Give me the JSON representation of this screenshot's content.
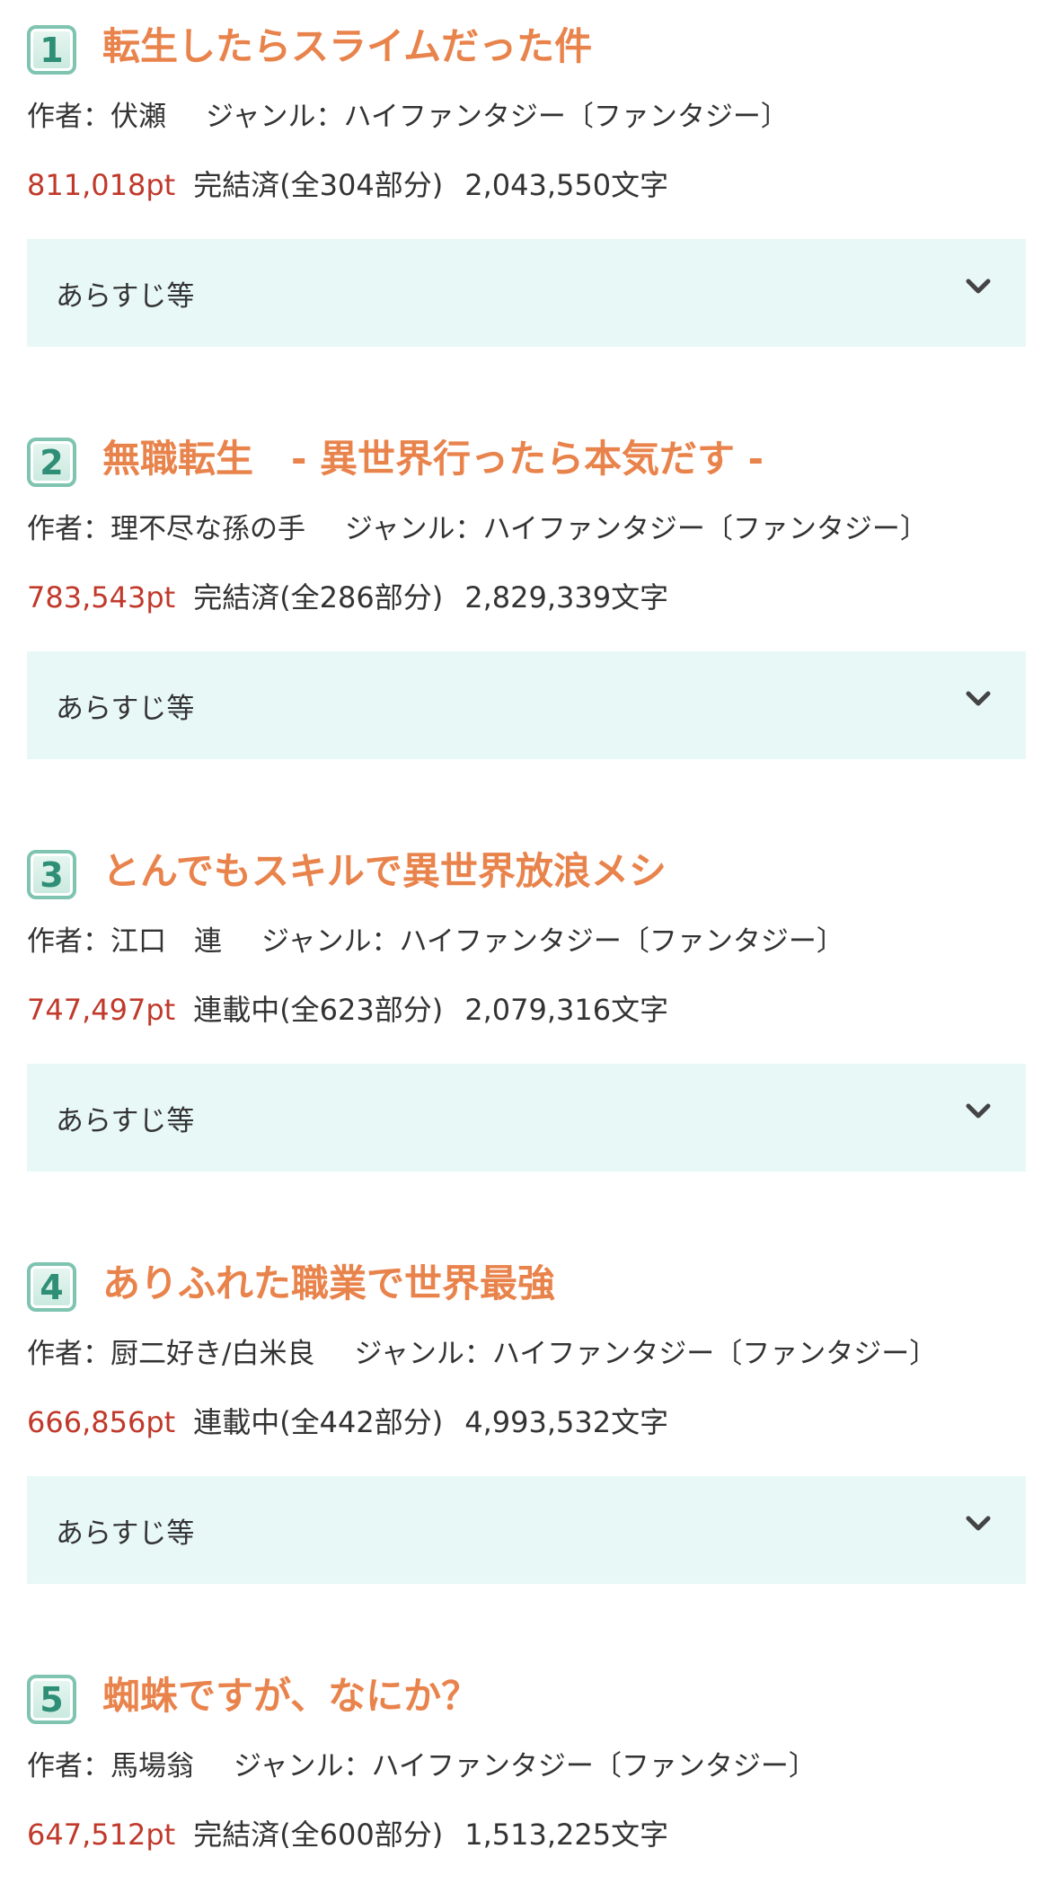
{
  "labels": {
    "author_prefix": "作者：",
    "genre_prefix": "ジャンル：",
    "synopsis": "あらすじ等"
  },
  "novels": [
    {
      "rank": "1",
      "title": "転生したらスライムだった件",
      "author": "伏瀬",
      "genre": "ハイファンタジー〔ファンタジー〕",
      "points": "811,018pt",
      "status": "完結済(全304部分)",
      "chars": "2,043,550文字"
    },
    {
      "rank": "2",
      "title": "無職転生　- 異世界行ったら本気だす -",
      "author": "理不尽な孫の手",
      "genre": "ハイファンタジー〔ファンタジー〕",
      "points": "783,543pt",
      "status": "完結済(全286部分)",
      "chars": "2,829,339文字"
    },
    {
      "rank": "3",
      "title": "とんでもスキルで異世界放浪メシ",
      "author": "江口　連",
      "genre": "ハイファンタジー〔ファンタジー〕",
      "points": "747,497pt",
      "status": "連載中(全623部分)",
      "chars": "2,079,316文字"
    },
    {
      "rank": "4",
      "title": "ありふれた職業で世界最強",
      "author": "厨二好き/白米良",
      "genre": "ハイファンタジー〔ファンタジー〕",
      "points": "666,856pt",
      "status": "連載中(全442部分)",
      "chars": "4,993,532文字"
    },
    {
      "rank": "5",
      "title": "蜘蛛ですが、なにか？",
      "author": "馬場翁",
      "genre": "ハイファンタジー〔ファンタジー〕",
      "points": "647,512pt",
      "status": "完結済(全600部分)",
      "chars": "1,513,225文字"
    }
  ],
  "icons": {
    "expand": "chevron-down-icon"
  },
  "colors": {
    "title": "#e9834c",
    "points": "#c0392b",
    "badge_border": "#7fc4b0",
    "badge_text": "#2e8f76",
    "synopsis_bg": "#e8f8f7",
    "text": "#333333"
  }
}
